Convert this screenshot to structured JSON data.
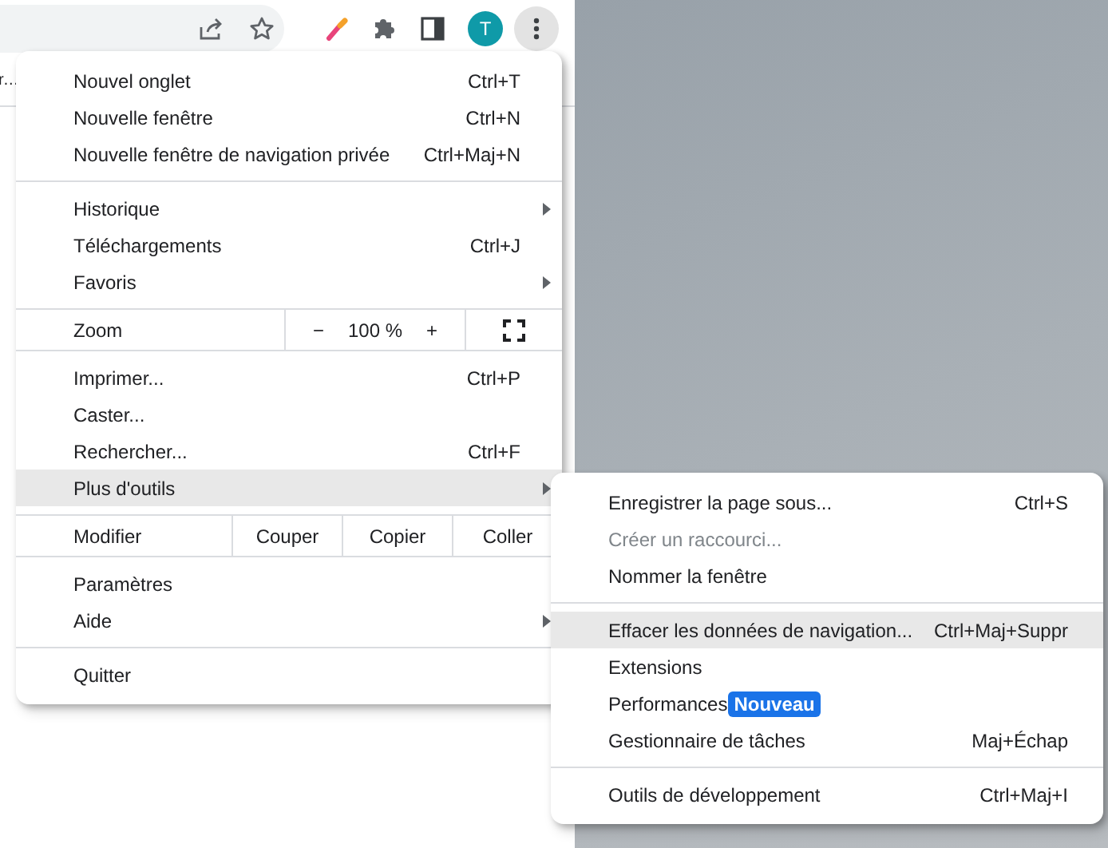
{
  "toolbar": {
    "avatar": "T",
    "menu_button": {
      "selected": true
    }
  },
  "bookmark_bar": {
    "items": [
      {
        "label": "r…"
      }
    ]
  },
  "menu": {
    "items": [
      {
        "kind": "item",
        "label": "Nouvel onglet",
        "shortcut": "Ctrl+T",
        "submenu": false,
        "selected": false
      },
      {
        "kind": "item",
        "label": "Nouvelle fenêtre",
        "shortcut": "Ctrl+N",
        "submenu": false,
        "selected": false
      },
      {
        "kind": "item",
        "label": "Nouvelle fenêtre de navigation privée",
        "shortcut": "Ctrl+Maj+N",
        "submenu": false,
        "selected": false
      },
      {
        "kind": "separator"
      },
      {
        "kind": "item",
        "label": "Historique",
        "submenu": true,
        "selected": false
      },
      {
        "kind": "item",
        "label": "Téléchargements",
        "shortcut": "Ctrl+J",
        "submenu": false,
        "selected": false
      },
      {
        "kind": "item",
        "label": "Favoris",
        "submenu": true,
        "selected": false
      },
      {
        "kind": "separator"
      },
      {
        "kind": "zoom",
        "label": "Zoom",
        "minus": "−",
        "value": "100 %",
        "plus": "+"
      },
      {
        "kind": "separator"
      },
      {
        "kind": "item",
        "label": "Imprimer...",
        "shortcut": "Ctrl+P",
        "submenu": false,
        "selected": false
      },
      {
        "kind": "item",
        "label": "Caster...",
        "submenu": false,
        "selected": false
      },
      {
        "kind": "item",
        "label": "Rechercher...",
        "shortcut": "Ctrl+F",
        "submenu": false,
        "selected": false
      },
      {
        "kind": "item",
        "label": "Plus d'outils",
        "submenu": true,
        "selected": true
      },
      {
        "kind": "separator"
      },
      {
        "kind": "edit",
        "label": "Modifier",
        "buttons": [
          "Couper",
          "Copier",
          "Coller"
        ]
      },
      {
        "kind": "separator"
      },
      {
        "kind": "item",
        "label": "Paramètres",
        "submenu": false,
        "selected": false
      },
      {
        "kind": "item",
        "label": "Aide",
        "submenu": true,
        "selected": false
      },
      {
        "kind": "separator"
      },
      {
        "kind": "item",
        "label": "Quitter",
        "submenu": false,
        "selected": false
      }
    ]
  },
  "submenu": {
    "items": [
      {
        "kind": "item",
        "label": "Enregistrer la page sous...",
        "shortcut": "Ctrl+S",
        "disabled": false,
        "selected": false
      },
      {
        "kind": "item",
        "label": "Créer un raccourci...",
        "disabled": true,
        "selected": false
      },
      {
        "kind": "item",
        "label": "Nommer la fenêtre",
        "disabled": false,
        "selected": false
      },
      {
        "kind": "separator"
      },
      {
        "kind": "item",
        "label": "Effacer les données de navigation...",
        "shortcut": "Ctrl+Maj+Suppr",
        "disabled": false,
        "selected": true
      },
      {
        "kind": "item",
        "label": "Extensions",
        "disabled": false,
        "selected": false
      },
      {
        "kind": "item",
        "label": "Performances",
        "badge": "Nouveau",
        "disabled": false,
        "selected": false
      },
      {
        "kind": "item",
        "label": "Gestionnaire de tâches",
        "shortcut": "Maj+Échap",
        "disabled": false,
        "selected": false
      },
      {
        "kind": "separator"
      },
      {
        "kind": "item",
        "label": "Outils de développement",
        "shortcut": "Ctrl+Maj+I",
        "disabled": false,
        "selected": false
      }
    ]
  }
}
